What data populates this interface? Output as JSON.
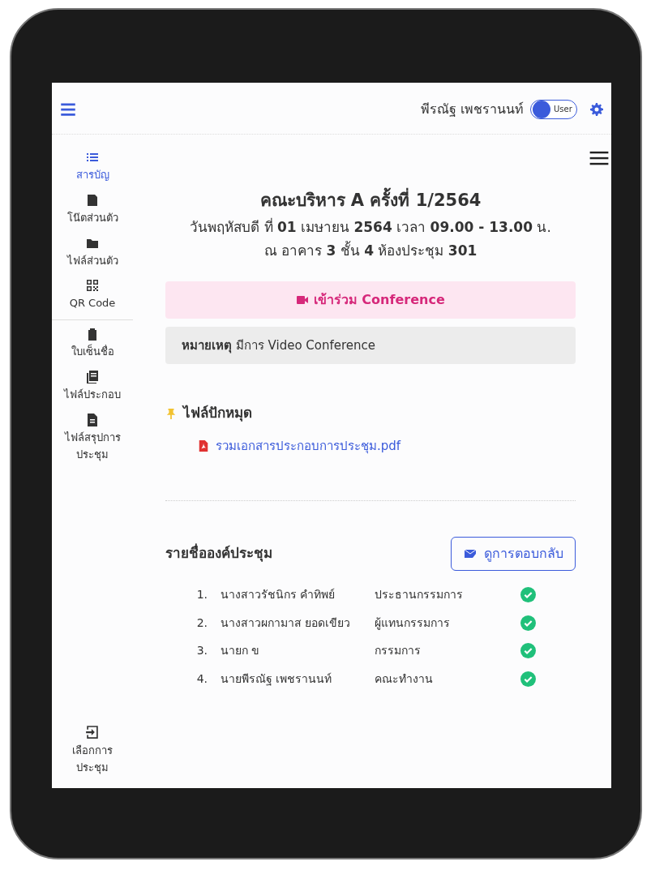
{
  "topbar": {
    "user_name": "พีรณัฐ เพชรานนท์",
    "role_toggle": {
      "label": "User"
    }
  },
  "sidebar": {
    "items": [
      {
        "label": "สารบัญ",
        "selected": true
      },
      {
        "label": "โน๊ตส่วนตัว",
        "selected": false
      },
      {
        "label": "ไฟล์ส่วนตัว",
        "selected": false
      },
      {
        "label": "QR Code",
        "selected": false
      },
      {
        "label": "ใบเซ็นชื่อ",
        "selected": false
      },
      {
        "label": "ไฟล์ประกอบ",
        "selected": false
      },
      {
        "label": "ไฟล์สรุปการประชุม",
        "selected": false
      }
    ],
    "bottom_item": {
      "label": "เลือกการประชุม"
    }
  },
  "meeting": {
    "title": "คณะบริหาร A ครั้งที่ 1/2564",
    "date_line": "วันพฤหัสบดี ที่ **01** เมษายน **2564** เวลา **09.00 - 13.00** น.",
    "place_line": "ณ อาคาร **3** ชั้น **4** ห้องประชุม **301**"
  },
  "conference_button": "เข้าร่วม Conference",
  "note": "**หมายเหตุ** มีการ Video Conference",
  "pinned_files": {
    "title": "ไฟล์ปักหมุด",
    "files": [
      "รวมเอกสารประกอบการประชุม.pdf"
    ]
  },
  "quorum": {
    "title": "รายชื่อองค์ประชุม",
    "feedback_button": "ดูการตอบกลับ",
    "members": [
      {
        "number": "1.",
        "name": "นางสาวรัชนิกร คำทิพย์",
        "role": "ประธานกรรมการ",
        "confirmed": true
      },
      {
        "number": "2.",
        "name": "นางสาวผกามาส ยอดเขียว",
        "role": "ผู้แทนกรรมการ",
        "confirmed": true
      },
      {
        "number": "3.",
        "name": "นายก ข",
        "role": "กรรมการ",
        "confirmed": true
      },
      {
        "number": "4.",
        "name": "นายพีรณัฐ เพชรานนท์",
        "role": "คณะทำงาน",
        "confirmed": true
      }
    ]
  }
}
